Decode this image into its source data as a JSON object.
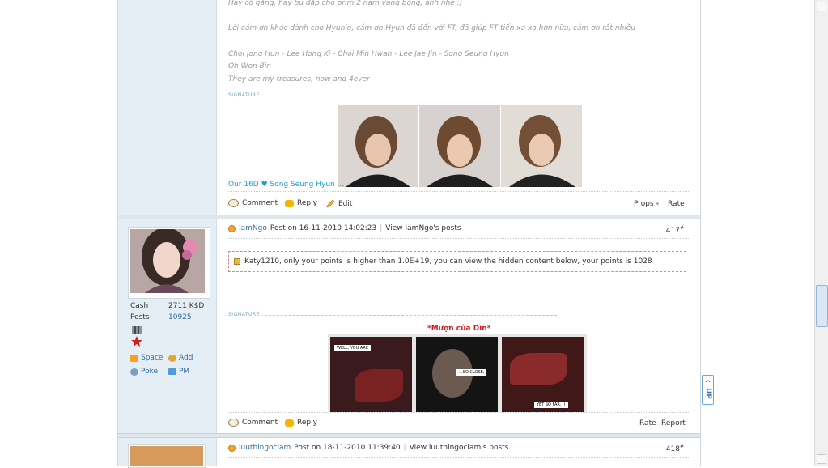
{
  "post1": {
    "lines": [
      "Hãy cố gắng, hãy bù đắp cho prim 2 năm vàng bông, anh nhé :)",
      "Lời cảm ơn khác dành cho Hyunie, cảm ơn Hyun đã đến với FT, đã giúp FT tiến xa xa hơn nữa, cảm ơn rất nhiều",
      "Choi Jong Hun - Lee Hong Ki - Choi Min Hwan - Lee Jae Jin - Song Seung Hyun",
      "Oh Won Bin",
      "They are my treasures, now and 4ever"
    ],
    "signature_label": "SIGNATURE",
    "signature_caption": "Our 16D ♥ Song Seung Hyun ...",
    "actions": {
      "comment": "Comment",
      "reply": "Reply",
      "edit": "Edit"
    },
    "right": {
      "props": "Props",
      "rate": "Rate"
    }
  },
  "post2": {
    "user": "IamNgo",
    "posted_on": "Post on 16-11-2010 14:02:23",
    "view_posts": "View IamNgo's posts",
    "floor": "417",
    "floor_mark": "#",
    "hidden_notice": "Katy1210, only your points is higher than 1.0E+19, you can view the hidden content below, your points is 1028",
    "signature_label": "SIGNATURE",
    "signature_title": "*Mượn của Dìn*",
    "comic_captions": [
      "WELL, YOU ARE",
      "...SO CLOSE,",
      "YET SO FAR. :)"
    ],
    "sidebar": {
      "cash_label": "Cash",
      "cash_value": "2711 K$D",
      "posts_label": "Posts",
      "posts_value": "10925",
      "links": {
        "space": "Space",
        "add": "Add",
        "poke": "Poke",
        "pm": "PM"
      }
    },
    "actions": {
      "comment": "Comment",
      "reply": "Reply"
    },
    "right": {
      "rate": "Rate",
      "report": "Report"
    }
  },
  "post3": {
    "user": "luuthingoclam",
    "posted_on": "Post on 18-11-2010 11:39:40",
    "view_posts": "View luuthingoclam's posts",
    "floor": "418",
    "floor_mark": "#"
  },
  "up_button": {
    "top": "UP",
    "arrow": "^"
  },
  "colors": {
    "sidebar_bg": "#e6eef5",
    "link_blue": "#2d6ea3",
    "accent_cyan": "#1aa0c8",
    "title_red": "#d02020"
  }
}
